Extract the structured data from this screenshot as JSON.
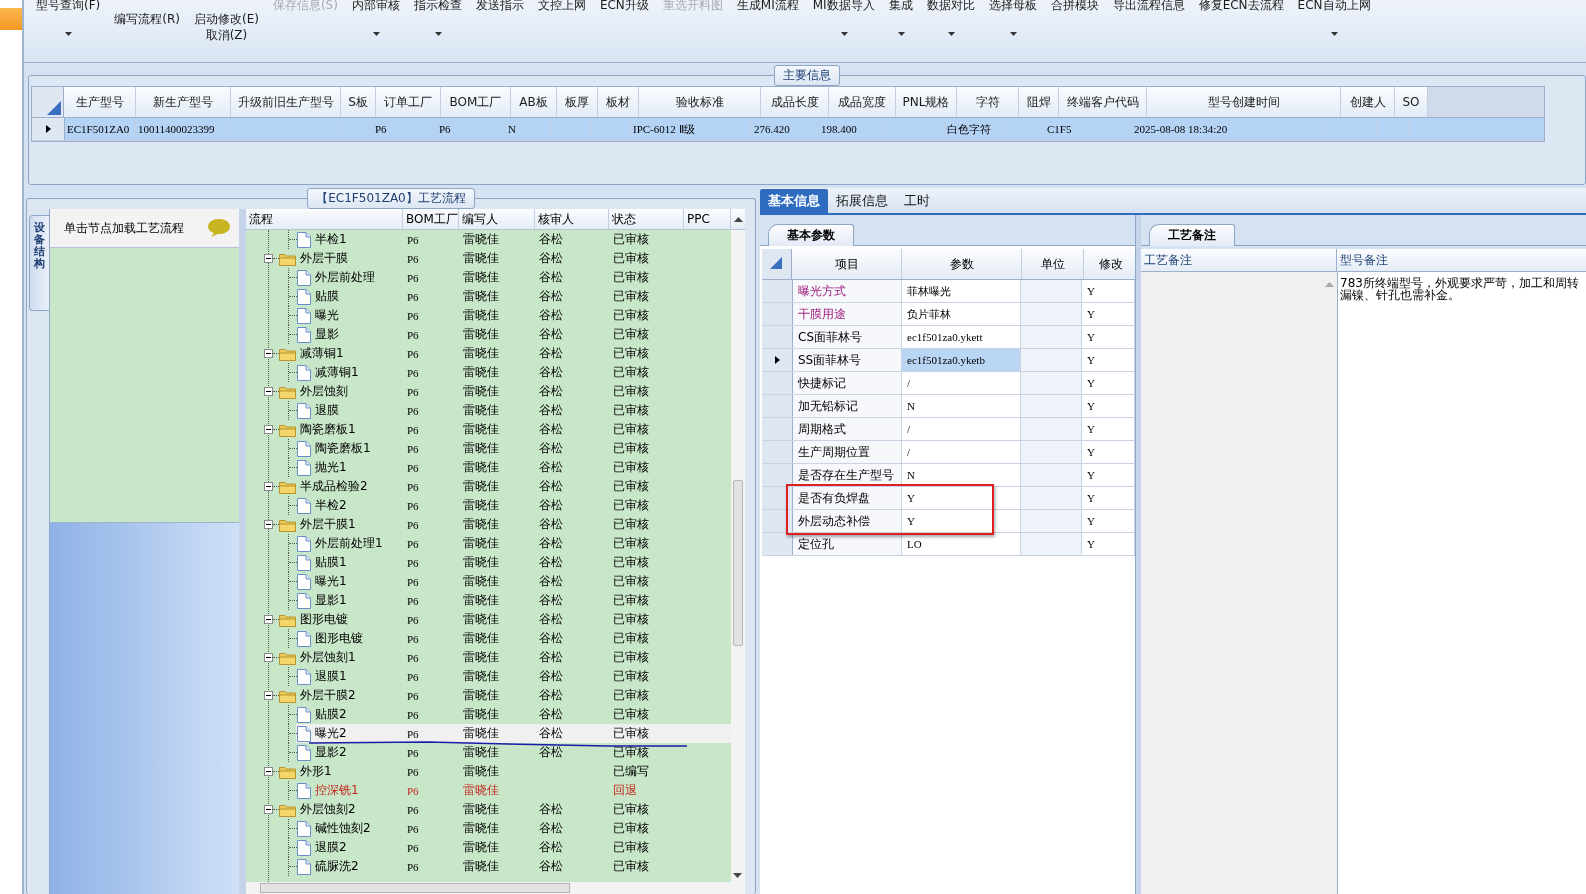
{
  "toolbar": [
    {
      "label": "型号查询(F)",
      "kind": "small",
      "disabled": false,
      "dropdown": true
    },
    {
      "label": "编写流程(R)",
      "kind": "large",
      "disabled": false,
      "dropdown": false
    },
    {
      "label": "启动修改(E)",
      "sublabel": "取消(Z)",
      "kind": "large",
      "disabled": false,
      "dropdown": false
    },
    {
      "label": "保存信息(S)",
      "kind": "small",
      "disabled": true,
      "dropdown": false
    },
    {
      "label": "内部审核",
      "kind": "small",
      "disabled": false,
      "dropdown": true
    },
    {
      "label": "指示检查",
      "kind": "small",
      "disabled": false,
      "dropdown": true
    },
    {
      "label": "发送指示",
      "kind": "small",
      "disabled": false,
      "dropdown": false
    },
    {
      "label": "文控上网",
      "kind": "small",
      "disabled": false,
      "dropdown": false
    },
    {
      "label": "ECN升级",
      "kind": "small",
      "disabled": false,
      "dropdown": false
    },
    {
      "label": "重选开料图",
      "kind": "small",
      "disabled": true,
      "dropdown": false
    },
    {
      "label": "生成MI流程",
      "kind": "small",
      "disabled": false,
      "dropdown": false
    },
    {
      "label": "MI数据导入",
      "kind": "small",
      "disabled": false,
      "dropdown": true
    },
    {
      "label": "集成",
      "kind": "small",
      "disabled": false,
      "dropdown": true
    },
    {
      "label": "数据对比",
      "kind": "small",
      "disabled": false,
      "dropdown": true
    },
    {
      "label": "选择母板",
      "kind": "small",
      "disabled": false,
      "dropdown": true
    },
    {
      "label": "合拼模块",
      "kind": "small",
      "disabled": false,
      "dropdown": false
    },
    {
      "label": "导出流程信息",
      "kind": "small",
      "disabled": false,
      "dropdown": false
    },
    {
      "label": "修复ECN去流程",
      "kind": "small",
      "disabled": false,
      "dropdown": false
    },
    {
      "label": "ECN自动上网",
      "kind": "small",
      "disabled": false,
      "dropdown": true
    }
  ],
  "main_info": {
    "title": "主要信息",
    "columns": [
      "生产型号",
      "新生产型号",
      "升级前旧生产型号",
      "S板",
      "订单工厂",
      "BOM工厂",
      "AB板",
      "板厚",
      "板材",
      "验收标准",
      "成品长度",
      "成品宽度",
      "PNL规格",
      "字符",
      "阻焊",
      "终端客户代码",
      "型号创建时间",
      "创建人",
      "SO"
    ],
    "rows": [
      {
        "selected": true,
        "cells": [
          "EC1F501ZA0",
          "10011400023399",
          null,
          null,
          "P6",
          "P6",
          "N",
          null,
          null,
          "IPC-6012 Ⅱ级",
          "276.420",
          "198.400",
          null,
          "白色字符",
          null,
          "C1F5",
          "2025-08-08 18:34:20",
          null,
          null
        ]
      }
    ]
  },
  "process": {
    "title": "【EC1F501ZA0】工艺流程",
    "side_tab": "设备结构",
    "hint": "单击节点加载工艺流程",
    "columns": [
      "流程",
      "BOM工厂",
      "编写人",
      "核审人",
      "状态",
      "PPC"
    ],
    "nodes": [
      {
        "name": "半检1",
        "kind": "file",
        "bom": "P6",
        "writer": "雷晓佳",
        "reviewer": "谷松",
        "status": "已审核",
        "selected": false,
        "returned": false
      },
      {
        "name": "外层干膜",
        "kind": "folder",
        "expanded": true,
        "bom": "P6",
        "writer": "雷晓佳",
        "reviewer": "谷松",
        "status": "已审核",
        "selected": false,
        "returned": false,
        "children": [
          {
            "name": "外层前处理",
            "kind": "file",
            "bom": "P6",
            "writer": "雷晓佳",
            "reviewer": "谷松",
            "status": "已审核",
            "selected": false,
            "returned": false
          },
          {
            "name": "贴膜",
            "kind": "file",
            "bom": "P6",
            "writer": "雷晓佳",
            "reviewer": "谷松",
            "status": "已审核",
            "selected": false,
            "returned": false
          },
          {
            "name": "曝光",
            "kind": "file",
            "bom": "P6",
            "writer": "雷晓佳",
            "reviewer": "谷松",
            "status": "已审核",
            "selected": false,
            "returned": false
          },
          {
            "name": "显影",
            "kind": "file",
            "bom": "P6",
            "writer": "雷晓佳",
            "reviewer": "谷松",
            "status": "已审核",
            "selected": false,
            "returned": false
          }
        ]
      },
      {
        "name": "减薄铜1",
        "kind": "folder",
        "expanded": true,
        "bom": "P6",
        "writer": "雷晓佳",
        "reviewer": "谷松",
        "status": "已审核",
        "selected": false,
        "returned": false,
        "children": [
          {
            "name": "减薄铜1",
            "kind": "file",
            "bom": "P6",
            "writer": "雷晓佳",
            "reviewer": "谷松",
            "status": "已审核",
            "selected": false,
            "returned": false
          }
        ]
      },
      {
        "name": "外层蚀刻",
        "kind": "folder",
        "expanded": true,
        "bom": "P6",
        "writer": "雷晓佳",
        "reviewer": "谷松",
        "status": "已审核",
        "selected": false,
        "returned": false,
        "children": [
          {
            "name": "退膜",
            "kind": "file",
            "bom": "P6",
            "writer": "雷晓佳",
            "reviewer": "谷松",
            "status": "已审核",
            "selected": false,
            "returned": false
          }
        ]
      },
      {
        "name": "陶瓷磨板1",
        "kind": "folder",
        "expanded": true,
        "bom": "P6",
        "writer": "雷晓佳",
        "reviewer": "谷松",
        "status": "已审核",
        "selected": false,
        "returned": false,
        "children": [
          {
            "name": "陶瓷磨板1",
            "kind": "file",
            "bom": "P6",
            "writer": "雷晓佳",
            "reviewer": "谷松",
            "status": "已审核",
            "selected": false,
            "returned": false
          },
          {
            "name": "抛光1",
            "kind": "file",
            "bom": "P6",
            "writer": "雷晓佳",
            "reviewer": "谷松",
            "status": "已审核",
            "selected": false,
            "returned": false
          }
        ]
      },
      {
        "name": "半成品检验2",
        "kind": "folder",
        "expanded": true,
        "bom": "P6",
        "writer": "雷晓佳",
        "reviewer": "谷松",
        "status": "已审核",
        "selected": false,
        "returned": false,
        "children": [
          {
            "name": "半检2",
            "kind": "file",
            "bom": "P6",
            "writer": "雷晓佳",
            "reviewer": "谷松",
            "status": "已审核",
            "selected": false,
            "returned": false
          }
        ]
      },
      {
        "name": "外层干膜1",
        "kind": "folder",
        "expanded": true,
        "bom": "P6",
        "writer": "雷晓佳",
        "reviewer": "谷松",
        "status": "已审核",
        "selected": false,
        "returned": false,
        "children": [
          {
            "name": "外层前处理1",
            "kind": "file",
            "bom": "P6",
            "writer": "雷晓佳",
            "reviewer": "谷松",
            "status": "已审核",
            "selected": false,
            "returned": false
          },
          {
            "name": "贴膜1",
            "kind": "file",
            "bom": "P6",
            "writer": "雷晓佳",
            "reviewer": "谷松",
            "status": "已审核",
            "selected": false,
            "returned": false
          },
          {
            "name": "曝光1",
            "kind": "file",
            "bom": "P6",
            "writer": "雷晓佳",
            "reviewer": "谷松",
            "status": "已审核",
            "selected": false,
            "returned": false
          },
          {
            "name": "显影1",
            "kind": "file",
            "bom": "P6",
            "writer": "雷晓佳",
            "reviewer": "谷松",
            "status": "已审核",
            "selected": false,
            "returned": false
          }
        ]
      },
      {
        "name": "图形电镀",
        "kind": "folder",
        "expanded": true,
        "bom": "P6",
        "writer": "雷晓佳",
        "reviewer": "谷松",
        "status": "已审核",
        "selected": false,
        "returned": false,
        "children": [
          {
            "name": "图形电镀",
            "kind": "file",
            "bom": "P6",
            "writer": "雷晓佳",
            "reviewer": "谷松",
            "status": "已审核",
            "selected": false,
            "returned": false
          }
        ]
      },
      {
        "name": "外层蚀刻1",
        "kind": "folder",
        "expanded": true,
        "bom": "P6",
        "writer": "雷晓佳",
        "reviewer": "谷松",
        "status": "已审核",
        "selected": false,
        "returned": false,
        "children": [
          {
            "name": "退膜1",
            "kind": "file",
            "bom": "P6",
            "writer": "雷晓佳",
            "reviewer": "谷松",
            "status": "已审核",
            "selected": false,
            "returned": false
          }
        ]
      },
      {
        "name": "外层干膜2",
        "kind": "folder",
        "expanded": true,
        "bom": "P6",
        "writer": "雷晓佳",
        "reviewer": "谷松",
        "status": "已审核",
        "selected": false,
        "returned": false,
        "children": [
          {
            "name": "贴膜2",
            "kind": "file",
            "bom": "P6",
            "writer": "雷晓佳",
            "reviewer": "谷松",
            "status": "已审核",
            "selected": false,
            "returned": false
          },
          {
            "name": "曝光2",
            "kind": "file",
            "bom": "P6",
            "writer": "雷晓佳",
            "reviewer": "谷松",
            "status": "已审核",
            "selected": true,
            "returned": false
          },
          {
            "name": "显影2",
            "kind": "file",
            "bom": "P6",
            "writer": "雷晓佳",
            "reviewer": "谷松",
            "status": "已审核",
            "selected": false,
            "returned": false
          }
        ]
      },
      {
        "name": "外形1",
        "kind": "folder",
        "expanded": true,
        "bom": "P6",
        "writer": "雷晓佳",
        "status": "已编写",
        "selected": false,
        "returned": false,
        "children": [
          {
            "name": "控深铣1",
            "kind": "file",
            "bom": "P6",
            "writer": "雷晓佳",
            "status": "回退",
            "selected": false,
            "returned": true
          }
        ]
      },
      {
        "name": "外层蚀刻2",
        "kind": "folder",
        "expanded": true,
        "bom": "P6",
        "writer": "雷晓佳",
        "reviewer": "谷松",
        "status": "已审核",
        "selected": false,
        "returned": false,
        "children": [
          {
            "name": "碱性蚀刻2",
            "kind": "file",
            "bom": "P6",
            "writer": "雷晓佳",
            "reviewer": "谷松",
            "status": "已审核",
            "selected": false,
            "returned": false
          },
          {
            "name": "退膜2",
            "kind": "file",
            "bom": "P6",
            "writer": "雷晓佳",
            "reviewer": "谷松",
            "status": "已审核",
            "selected": false,
            "returned": false
          },
          {
            "name": "硫脲洗2",
            "kind": "file",
            "bom": "P6",
            "writer": "雷晓佳",
            "reviewer": "谷松",
            "status": "已审核",
            "selected": false,
            "returned": false
          }
        ]
      }
    ]
  },
  "details": {
    "tabs": [
      {
        "label": "基本信息",
        "selected": true
      },
      {
        "label": "拓展信息",
        "selected": false
      },
      {
        "label": "工时",
        "selected": false
      }
    ],
    "params_tab": "基本参数",
    "params_columns": [
      "项目",
      "参数",
      "单位",
      "修改"
    ],
    "params": [
      {
        "item": "曝光方式",
        "value": "菲林曝光",
        "modify": "Y",
        "emphasized": true,
        "selected": false
      },
      {
        "item": "干膜用途",
        "value": "负片菲林",
        "modify": "Y",
        "emphasized": true,
        "selected": false
      },
      {
        "item": "CS面菲林号",
        "value": "ec1f501za0.ykett",
        "modify": "Y",
        "emphasized": false,
        "selected": false
      },
      {
        "item": "SS面菲林号",
        "value": "ec1f501za0.yketb",
        "modify": "Y",
        "emphasized": false,
        "selected": true
      },
      {
        "item": "快捷标记",
        "value": "/",
        "modify": "Y",
        "emphasized": false,
        "selected": false
      },
      {
        "item": "加无铅标记",
        "value": "N",
        "modify": "Y",
        "emphasized": false,
        "selected": false
      },
      {
        "item": "周期格式",
        "value": "/",
        "modify": "Y",
        "emphasized": false,
        "selected": false
      },
      {
        "item": "生产周期位置",
        "value": "/",
        "modify": "Y",
        "emphasized": false,
        "selected": false
      },
      {
        "item": "是否存在生产型号",
        "value": "N",
        "modify": "Y",
        "emphasized": false,
        "selected": false
      },
      {
        "item": "是否有负焊盘",
        "value": "Y",
        "modify": "Y",
        "emphasized": false,
        "selected": false
      },
      {
        "item": "外层动态补偿",
        "value": "Y",
        "modify": "Y",
        "emphasized": false,
        "selected": false
      },
      {
        "item": "定位孔",
        "value": "LO",
        "modify": "Y",
        "emphasized": false,
        "selected": false
      }
    ],
    "notes_tab": "工艺备注",
    "notes_columns": [
      "工艺备注",
      "型号备注"
    ],
    "model_note": [
      "783所终端型号，外观要求严苛，加工和周转",
      "漏镍、针孔也需补金。"
    ]
  }
}
